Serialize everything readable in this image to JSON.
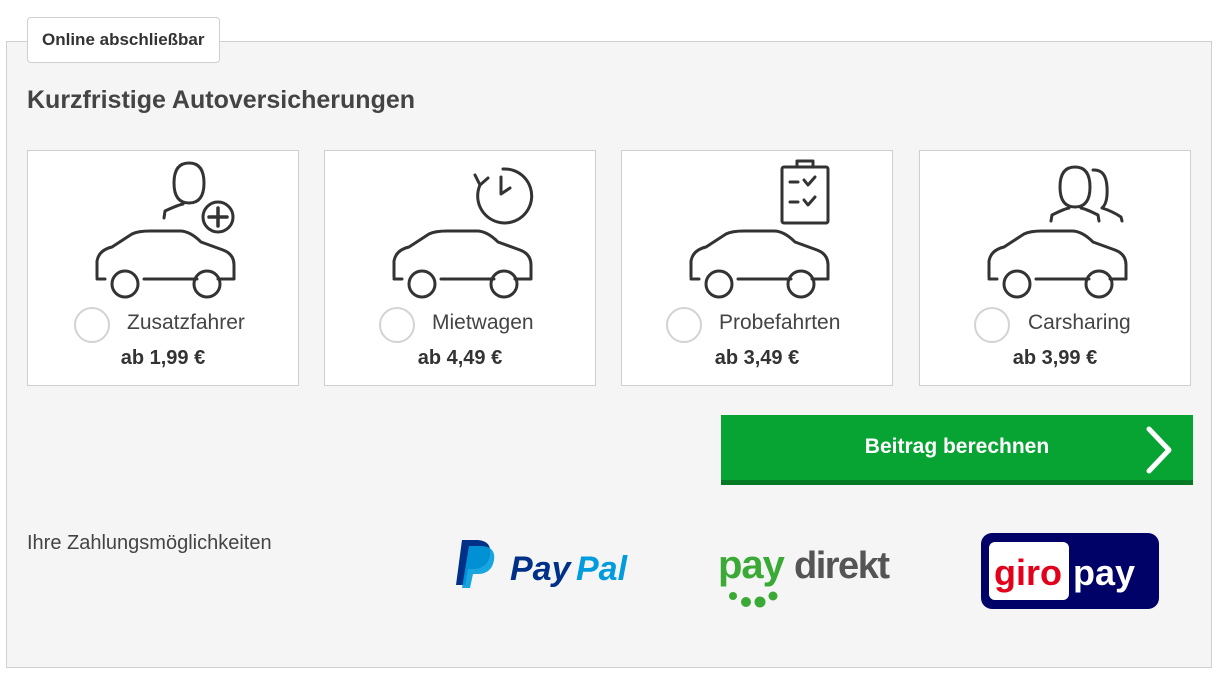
{
  "badge": {
    "label": "Online abschließbar"
  },
  "section": {
    "title": "Kurzfristige Autoversicherungen"
  },
  "options": [
    {
      "label": "Zusatzfahrer",
      "price": "ab 1,99 €",
      "icon": "car-add-driver-icon",
      "selected": false
    },
    {
      "label": "Mietwagen",
      "price": "ab 4,49 €",
      "icon": "car-clock-icon",
      "selected": false
    },
    {
      "label": "Probefahrten",
      "price": "ab 3,49 €",
      "icon": "car-checklist-icon",
      "selected": false
    },
    {
      "label": "Carsharing",
      "price": "ab 3,99 €",
      "icon": "car-two-people-icon",
      "selected": false
    }
  ],
  "cta": {
    "label": "Beitrag berechnen",
    "icon": "chevron-right-icon",
    "color": "#07a333"
  },
  "payment": {
    "label": "Ihre Zahlungsmöglichkeiten",
    "paypal": {
      "pay": "Pay",
      "pal": "Pal"
    },
    "paydirekt": {
      "pay": "pay",
      "direkt": "direkt"
    },
    "giropay": {
      "giro": "giro",
      "pay": "pay"
    }
  },
  "colors": {
    "panel_bg": "#f5f5f5",
    "cta_green": "#07a333",
    "paypal_dark": "#003087",
    "paypal_light": "#009cde",
    "paydirekt_green": "#3aa935",
    "giropay_navy": "#000268",
    "giropay_red": "#e2001a"
  }
}
